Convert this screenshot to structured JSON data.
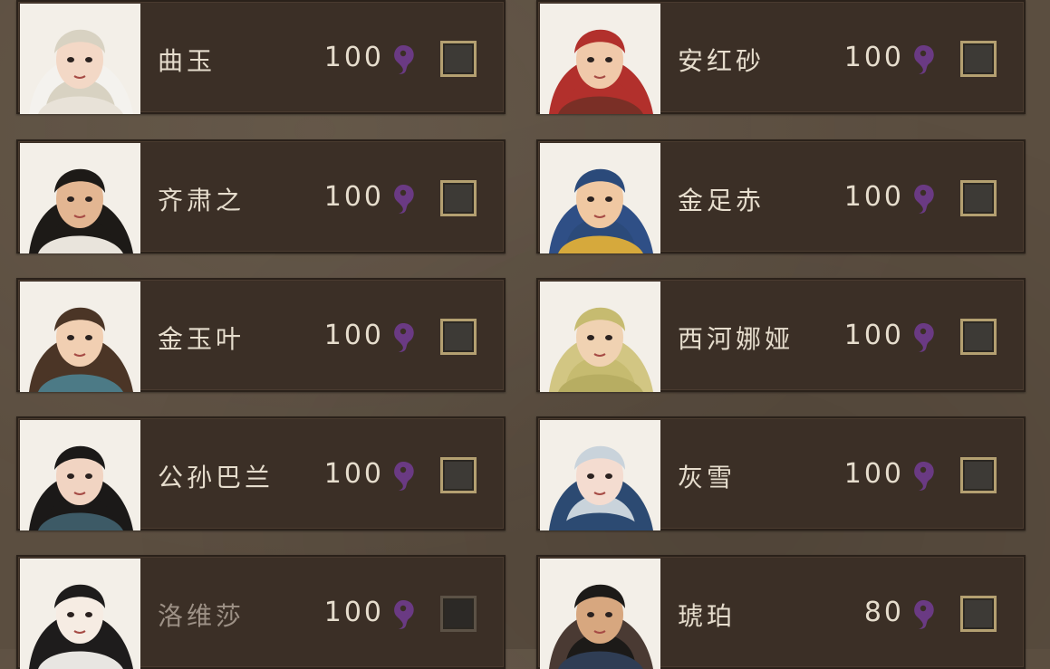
{
  "characters": [
    {
      "name": "曲玉",
      "cost": "100",
      "hair": "#d8d2c2",
      "hood": "#f4f2ee",
      "skin": "#f3d8c6",
      "cloth": "#e8e2d8",
      "dim": false
    },
    {
      "name": "安红砂",
      "cost": "100",
      "hair": "#b2302c",
      "hood": "#b2302c",
      "skin": "#f0c9aa",
      "cloth": "#7a2f26",
      "dim": false
    },
    {
      "name": "齐肃之",
      "cost": "100",
      "hair": "#1d1a17",
      "hood": "#1d1a17",
      "skin": "#e3b692",
      "cloth": "#e9e4dc",
      "dim": false
    },
    {
      "name": "金足赤",
      "cost": "100",
      "hair": "#2b4a7a",
      "hood": "#2f4f86",
      "skin": "#f0c8a2",
      "cloth": "#d6a93c",
      "dim": false
    },
    {
      "name": "金玉叶",
      "cost": "100",
      "hair": "#4b3526",
      "hood": "#4b3526",
      "skin": "#f1cfb2",
      "cloth": "#4c7a86",
      "dim": false
    },
    {
      "name": "西河娜娅",
      "cost": "100",
      "hair": "#c6bb70",
      "hood": "#d2c683",
      "skin": "#f0d2b2",
      "cloth": "#b7ad62",
      "dim": false
    },
    {
      "name": "公孙巴兰",
      "cost": "100",
      "hair": "#1b1918",
      "hood": "#1b1918",
      "skin": "#f1d4c2",
      "cloth": "#3d5a66",
      "dim": false
    },
    {
      "name": "灰雪",
      "cost": "100",
      "hair": "#c9d3db",
      "hood": "#2c4a72",
      "skin": "#f4dcd0",
      "cloth": "#2c4a72",
      "dim": false
    },
    {
      "name": "洛维莎",
      "cost": "100",
      "hair": "#1e1c1c",
      "hood": "#1e1c1c",
      "skin": "#f6ece3",
      "cloth": "#e8e6e2",
      "dim": true
    },
    {
      "name": "琥珀",
      "cost": "80",
      "hair": "#1c1a18",
      "hood": "#4a3a33",
      "skin": "#d7a77f",
      "cloth": "#2f3d54",
      "dim": false
    }
  ],
  "colors": {
    "card_bg": "#3b2f26",
    "text": "#e6ddcd",
    "dim_text": "#9d9186",
    "yin_yang": "#6a3a83",
    "checkbox_border": "#b4a071"
  },
  "icons": {
    "cost": "yin-yang-icon",
    "checkbox": "checkbox-unchecked-icon"
  }
}
